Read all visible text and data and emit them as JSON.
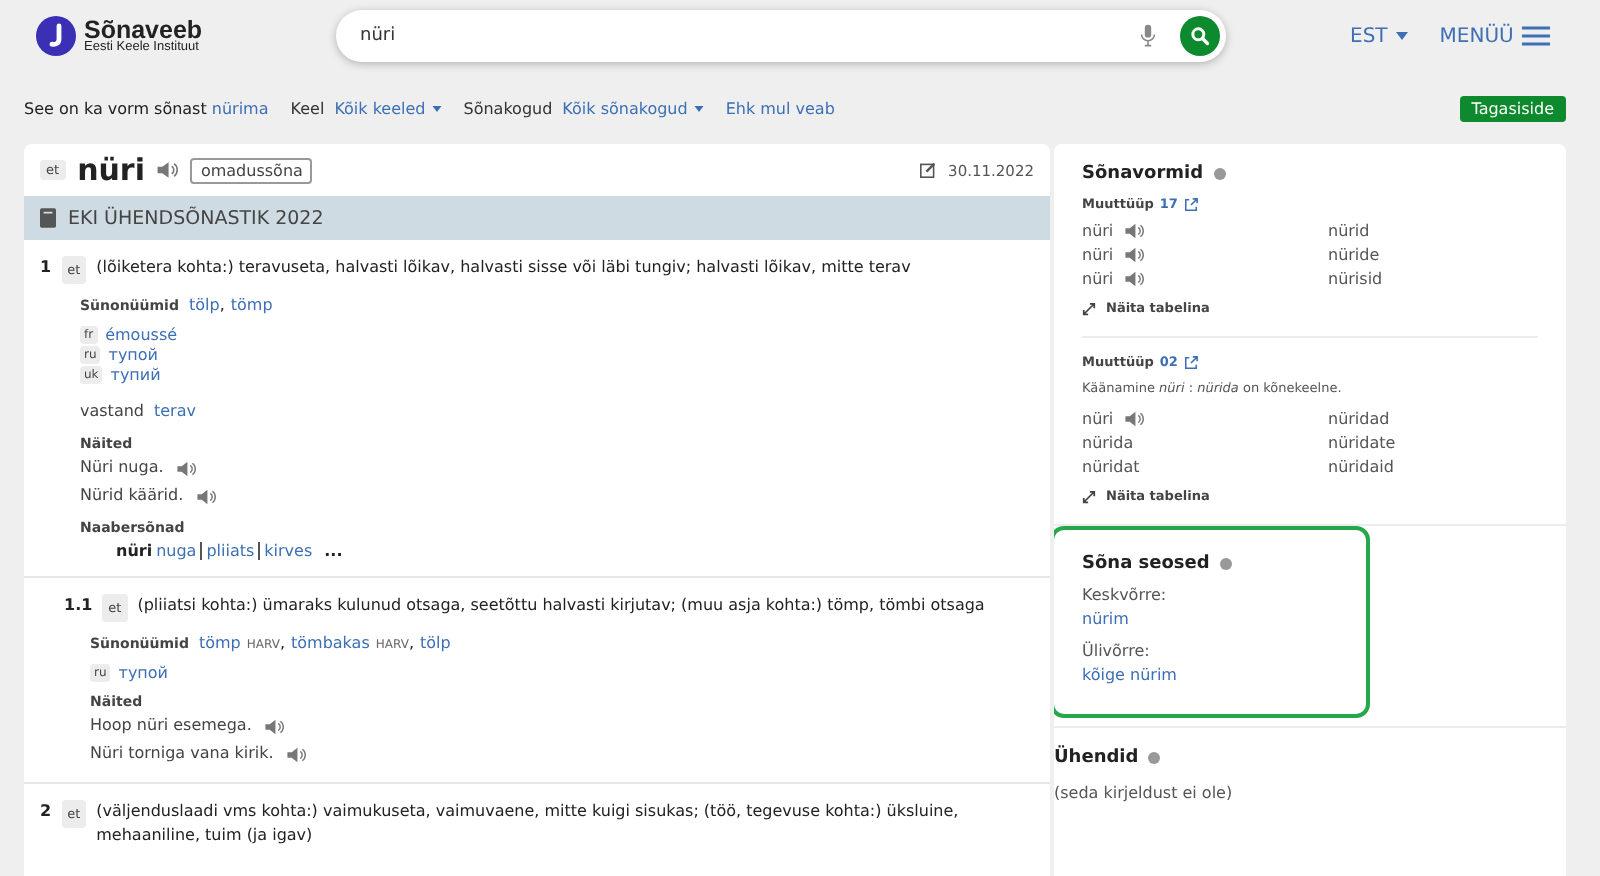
{
  "header": {
    "logo_title": "Sõnaveeb",
    "logo_subtitle": "Eesti Keele Instituut",
    "search": {
      "value": "nüri"
    },
    "language": "EST",
    "menu": "MENÜÜ"
  },
  "filters": {
    "form_note": "See on ka vorm sõnast",
    "form_link": "nürima",
    "selects": [
      {
        "label": "Keel",
        "value": "Kõik keeled"
      },
      {
        "label": "Sõnakogud",
        "value": "Kõik sõnakogud"
      }
    ],
    "alt_link": "Ehk mul veab",
    "feedback": "Tagasiside"
  },
  "entry": {
    "lang": "et",
    "word": "nüri",
    "pos": "omadussõna",
    "date": "30.11.2022",
    "dictionary": "EKI ÜHENDSÕNASTIK 2022",
    "senses": [
      {
        "number": "1",
        "sub": false,
        "lang": "et",
        "definition": "(lõiketera kohta:) teravuseta, halvasti lõikav, halvasti sisse või läbi tungiv;  halvasti lõikav, mitte terav",
        "synonyms_label": "Sünonüümid",
        "synonyms": [
          {
            "word": "tölp",
            "separator": ","
          },
          {
            "word": "tömp"
          }
        ],
        "translations": [
          {
            "lang": "fr",
            "word": "émoussé"
          },
          {
            "lang": "ru",
            "word": "тупой"
          },
          {
            "lang": "uk",
            "word": "тупий"
          }
        ],
        "antonym": {
          "label": "vastand",
          "word": "terav"
        },
        "examples_label": "Näited",
        "examples": [
          "Nüri nuga.",
          "Nürid käärid."
        ],
        "neighbors": {
          "label": "Naabersõnad",
          "head": "nüri",
          "words": [
            "nuga",
            "pliiats",
            "kirves"
          ],
          "more": "..."
        }
      },
      {
        "number": "1.1",
        "sub": true,
        "lang": "et",
        "definition": "(pliiatsi kohta:) ümaraks kulunud otsaga, seetõttu halvasti kirjutav;  (muu asja kohta:) tömp, tömbi otsaga",
        "synonyms_label": "Sünonüümid",
        "synonyms": [
          {
            "word": "tömp",
            "register": "HARV",
            "separator": ","
          },
          {
            "word": "tömbakas",
            "register": "HARV",
            "separator": ","
          },
          {
            "word": "tölp"
          }
        ],
        "translations": [
          {
            "lang": "ru",
            "word": "тупой"
          }
        ],
        "examples_label": "Näited",
        "examples": [
          "Hoop nüri esemega.",
          "Nüri torniga vana kirik."
        ]
      },
      {
        "number": "2",
        "sub": false,
        "lang": "et",
        "definition": "(väljenduslaadi vms kohta:) vaimukuseta, vaimuvaene, mitte kuigi sisukas;  (töö, tegevuse kohta:) üksluine, mehaaniline, tuim (ja igav)"
      }
    ]
  },
  "side": {
    "forms_title": "Sõnavormid",
    "paradigms": [
      {
        "type_label": "Muuttüüp",
        "type": "17",
        "forms": [
          {
            "left": "nüri",
            "audio": true,
            "right": "nürid"
          },
          {
            "left": "nüri",
            "audio": true,
            "right": "nüride"
          },
          {
            "left": "nüri",
            "audio": true,
            "right": "nürisid"
          }
        ],
        "table_link": "Näita tabelina"
      },
      {
        "type_label": "Muuttüüp",
        "type": "02",
        "note": "Käänamine *nüri* : *nürida* on kõnekeelne.",
        "forms": [
          {
            "left": "nüri",
            "audio": true,
            "right": "nüridad"
          },
          {
            "left": "nürida",
            "audio": false,
            "right": "nüridate"
          },
          {
            "left": "nüridat",
            "audio": false,
            "right": "nüridaid"
          }
        ],
        "table_link": "Näita tabelina"
      }
    ],
    "relations": {
      "title": "Sõna seosed",
      "highlighted": true,
      "groups": [
        {
          "label": "Keskvõrre:",
          "word": "nürim"
        },
        {
          "label": "Ülivõrre:",
          "word": "kõige nürim"
        }
      ]
    },
    "compounds": {
      "title": "Ühendid",
      "empty": "(seda kirjeldust ei ole)"
    }
  }
}
